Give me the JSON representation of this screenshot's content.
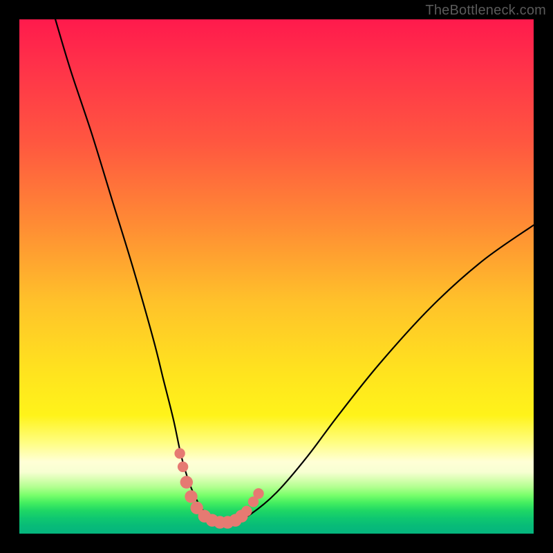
{
  "watermark": "TheBottleneck.com",
  "chart_data": {
    "type": "line",
    "title": "",
    "xlabel": "",
    "ylabel": "",
    "xlim": [
      0,
      100
    ],
    "ylim": [
      0,
      100
    ],
    "background_gradient": {
      "stops": [
        {
          "pos": 0,
          "color": "#ff1a4c"
        },
        {
          "pos": 24,
          "color": "#ff5740"
        },
        {
          "pos": 55,
          "color": "#ffc22a"
        },
        {
          "pos": 77,
          "color": "#fff31a"
        },
        {
          "pos": 86,
          "color": "#ffffd6"
        },
        {
          "pos": 92,
          "color": "#7aff6c"
        },
        {
          "pos": 100,
          "color": "#05b57e"
        }
      ]
    },
    "series": [
      {
        "name": "bottleneck-curve",
        "stroke": "#000000",
        "x": [
          7,
          10,
          14,
          18,
          22,
          26,
          28,
          30,
          31.5,
          33,
          34.5,
          36,
          38,
          40,
          42,
          45,
          50,
          56,
          62,
          70,
          80,
          90,
          100
        ],
        "y": [
          100,
          90,
          78,
          65,
          52,
          38,
          30,
          22,
          15,
          10,
          6.5,
          4.2,
          2.7,
          2.1,
          2.4,
          3.8,
          8,
          15,
          23,
          33,
          44,
          53,
          60
        ]
      }
    ],
    "markers": {
      "name": "highlighted-range",
      "color": "#e67a72",
      "points": [
        {
          "x": 31.2,
          "y": 15.6,
          "r": 1.0
        },
        {
          "x": 31.8,
          "y": 13.0,
          "r": 1.0
        },
        {
          "x": 32.5,
          "y": 10.0,
          "r": 1.4
        },
        {
          "x": 33.4,
          "y": 7.2,
          "r": 1.4
        },
        {
          "x": 34.5,
          "y": 5.0,
          "r": 1.4
        },
        {
          "x": 36.0,
          "y": 3.4,
          "r": 1.4
        },
        {
          "x": 37.5,
          "y": 2.6,
          "r": 1.4
        },
        {
          "x": 39.0,
          "y": 2.2,
          "r": 1.4
        },
        {
          "x": 40.5,
          "y": 2.2,
          "r": 1.4
        },
        {
          "x": 42.0,
          "y": 2.6,
          "r": 1.4
        },
        {
          "x": 43.2,
          "y": 3.4,
          "r": 1.4
        },
        {
          "x": 44.2,
          "y": 4.4,
          "r": 1.0
        },
        {
          "x": 45.5,
          "y": 6.2,
          "r": 1.0
        },
        {
          "x": 46.5,
          "y": 7.8,
          "r": 1.0
        }
      ]
    }
  }
}
